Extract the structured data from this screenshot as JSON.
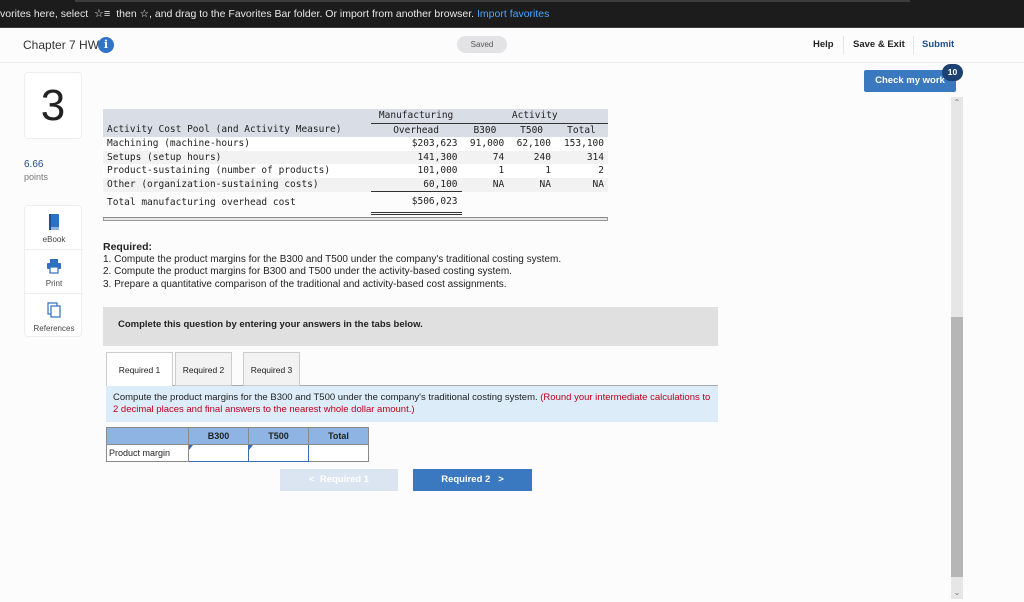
{
  "favorites_bar": {
    "text_before": "vorites here, select",
    "glyph1": "☆≡",
    "text_middle": "then ☆, and drag to the Favorites Bar folder. Or import from another browser.",
    "link": "Import favorites"
  },
  "header": {
    "title": "Chapter 7 HW",
    "info_icon": "i",
    "saved_status": "Saved",
    "help": "Help",
    "save_exit": "Save & Exit",
    "submit": "Submit"
  },
  "check_work": {
    "label": "Check my work",
    "badge": "10"
  },
  "question": {
    "number": "3",
    "points_value": "6.66",
    "points_label": "points"
  },
  "tools": [
    {
      "label": "eBook",
      "icon": "book-icon"
    },
    {
      "label": "Print",
      "icon": "printer-icon"
    },
    {
      "label": "References",
      "icon": "references-icon"
    }
  ],
  "data_table": {
    "header_row0": {
      "col1": "Manufacturing",
      "activity": "Activity"
    },
    "header_row1": {
      "pool": "Activity Cost Pool (and Activity Measure)",
      "overhead": "Overhead",
      "b300": "B300",
      "t500": "T500",
      "total": "Total"
    },
    "rows": [
      {
        "pool": "Machining (machine-hours)",
        "overhead": "$203,623",
        "b300": "91,000",
        "t500": "62,100",
        "total": "153,100"
      },
      {
        "pool": "Setups (setup hours)",
        "overhead": "141,300",
        "b300": "74",
        "t500": "240",
        "total": "314"
      },
      {
        "pool": "Product-sustaining (number of products)",
        "overhead": "101,000",
        "b300": "1",
        "t500": "1",
        "total": "2"
      },
      {
        "pool": "Other (organization-sustaining costs)",
        "overhead": "60,100",
        "b300": "NA",
        "t500": "NA",
        "total": "NA"
      }
    ],
    "total_row": {
      "label": "Total manufacturing overhead cost",
      "overhead": "$506,023"
    }
  },
  "required": {
    "heading": "Required:",
    "items": [
      "1. Compute the product margins for the B300 and T500 under the company's traditional costing system.",
      "2. Compute the product margins for B300 and T500 under the activity-based costing system.",
      "3. Prepare a quantitative comparison of the traditional and activity-based cost assignments."
    ]
  },
  "instructions_banner": "Complete this question by entering your answers in the tabs below.",
  "tabs": [
    {
      "label": "Required 1",
      "active": true
    },
    {
      "label": "Required 2",
      "active": false
    },
    {
      "label": "Required 3",
      "active": false
    }
  ],
  "tab_instruction": {
    "text": "Compute the product margins for the B300 and T500 under the company's traditional costing system.",
    "note": "(Round your intermediate calculations to 2 decimal places and final answers to the nearest whole dollar amount.)"
  },
  "answer_table": {
    "headers": [
      "",
      "B300",
      "T500",
      "Total"
    ],
    "row_label": "Product margin",
    "values": {
      "b300": "",
      "t500": "",
      "total": ""
    }
  },
  "nav": {
    "prev": "Required 1",
    "next": "Required 2"
  },
  "colors": {
    "accent": "#3a78c0",
    "dark_badge": "#1d4271",
    "note_red": "#c0001c",
    "instruction_bg": "#dcecf8",
    "table_header_bg": "#8db4e2"
  }
}
